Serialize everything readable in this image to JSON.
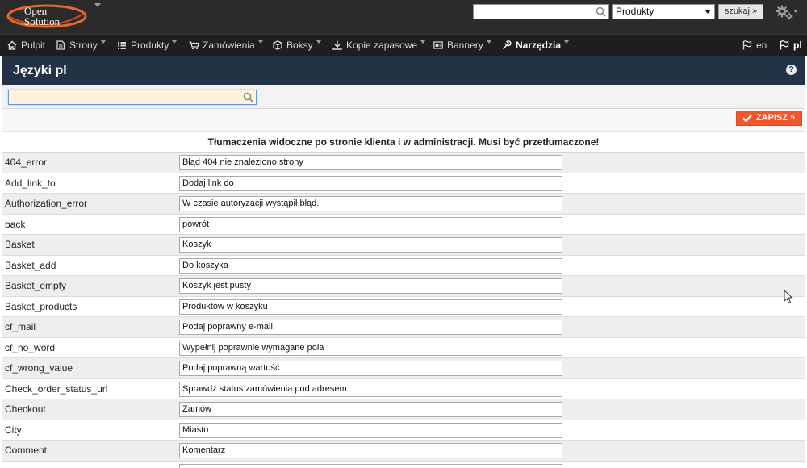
{
  "brand": {
    "logo_line1": "Open",
    "logo_line2": "Solution"
  },
  "topbar": {
    "search_value": "",
    "category_select": "Produkty",
    "search_button": "szukaj »"
  },
  "nav": {
    "items": [
      {
        "label": "Pulpit",
        "icon": "home-icon",
        "dropdown": false
      },
      {
        "label": "Strony",
        "icon": "page-icon",
        "dropdown": true
      },
      {
        "label": "Produkty",
        "icon": "list-icon",
        "dropdown": true
      },
      {
        "label": "Zamówienia",
        "icon": "cart-icon",
        "dropdown": true
      },
      {
        "label": "Boksy",
        "icon": "box-icon",
        "dropdown": true
      },
      {
        "label": "Kopie zapasowe",
        "icon": "download-icon",
        "dropdown": true
      },
      {
        "label": "Bannery",
        "icon": "banner-icon",
        "dropdown": true
      },
      {
        "label": "Narzędzia",
        "icon": "wrench-icon",
        "dropdown": true
      }
    ],
    "lang_en": "en",
    "lang_pl": "pl"
  },
  "page": {
    "title": "Języki pl",
    "help_glyph": "?"
  },
  "filter": {
    "value": ""
  },
  "toolbar": {
    "save_label": "ZAPISZ »"
  },
  "notice": "Tłumaczenia widoczne po stronie klienta i w administracji. Musi być przetłumaczone!",
  "translations": [
    {
      "key": "404_error",
      "value": "Błąd 404 nie znaleziono strony"
    },
    {
      "key": "Add_link_to",
      "value": "Dodaj link do"
    },
    {
      "key": "Authorization_error",
      "value": "W czasie autoryzacji wystąpił błąd."
    },
    {
      "key": "back",
      "value": "powrót"
    },
    {
      "key": "Basket",
      "value": "Koszyk"
    },
    {
      "key": "Basket_add",
      "value": "Do koszyka"
    },
    {
      "key": "Basket_empty",
      "value": "Koszyk jest pusty"
    },
    {
      "key": "Basket_products",
      "value": "Produktów w koszyku"
    },
    {
      "key": "cf_mail",
      "value": "Podaj poprawny e-mail"
    },
    {
      "key": "cf_no_word",
      "value": "Wypełnij poprawnie wymagane pola"
    },
    {
      "key": "cf_wrong_value",
      "value": "Podaj poprawną wartość"
    },
    {
      "key": "Check_order_status_url",
      "value": "Sprawdź status zamówienia pod adresem:"
    },
    {
      "key": "Checkout",
      "value": "Zamów"
    },
    {
      "key": "City",
      "value": "Miasto"
    },
    {
      "key": "Comment",
      "value": "Komentarz"
    },
    {
      "key": "",
      "value": ""
    }
  ],
  "colors": {
    "accent": "#f1562c",
    "header": "#233247",
    "topbar": "#2b2b2b",
    "navbar": "#1e1e1e"
  }
}
